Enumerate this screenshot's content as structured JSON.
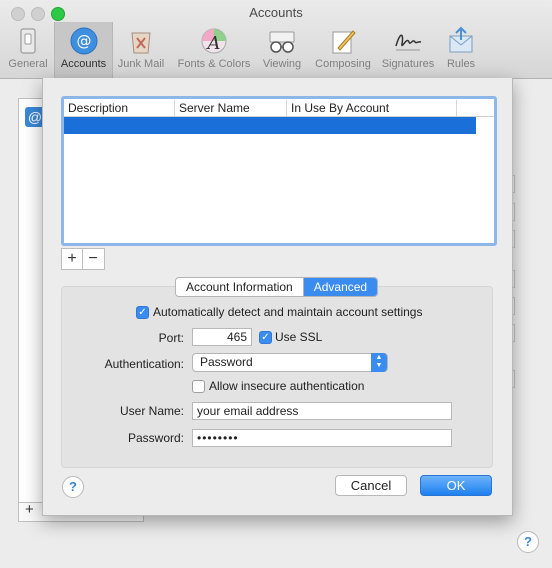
{
  "window": {
    "title": "Accounts"
  },
  "toolbar": {
    "items": [
      {
        "label": "General",
        "icon": "general-switch-icon"
      },
      {
        "label": "Accounts",
        "icon": "at-sign-icon"
      },
      {
        "label": "Junk Mail",
        "icon": "junk-mail-icon"
      },
      {
        "label": "Fonts & Colors",
        "icon": "fonts-colors-icon"
      },
      {
        "label": "Viewing",
        "icon": "glasses-icon"
      },
      {
        "label": "Composing",
        "icon": "pencil-paper-icon"
      },
      {
        "label": "Signatures",
        "icon": "signature-icon"
      },
      {
        "label": "Rules",
        "icon": "rules-icon"
      }
    ],
    "selected": "Accounts"
  },
  "background": {
    "add_label": "+",
    "help_label": "?"
  },
  "sheet": {
    "table": {
      "columns": [
        "Description",
        "Server Name",
        "In Use By Account"
      ],
      "rows": [
        [
          "",
          "",
          ""
        ]
      ]
    },
    "add_label": "+",
    "remove_label": "−",
    "tabs": [
      {
        "label": "Account Information",
        "selected": false
      },
      {
        "label": "Advanced",
        "selected": true
      }
    ],
    "auto_detect": {
      "label": "Automatically detect and maintain account settings",
      "checked": true
    },
    "port": {
      "label": "Port:",
      "value": "465"
    },
    "use_ssl": {
      "label": "Use SSL",
      "checked": true
    },
    "authentication": {
      "label": "Authentication:",
      "value": "Password"
    },
    "allow_insecure": {
      "label": "Allow insecure authentication",
      "checked": false
    },
    "user_name": {
      "label": "User Name:",
      "value": "your email address"
    },
    "password": {
      "label": "Password:",
      "value": "••••••••"
    },
    "help_label": "?",
    "cancel_label": "Cancel",
    "ok_label": "OK"
  },
  "colors": {
    "accent": "#3b8cf0",
    "selection": "#1b6fd9"
  }
}
